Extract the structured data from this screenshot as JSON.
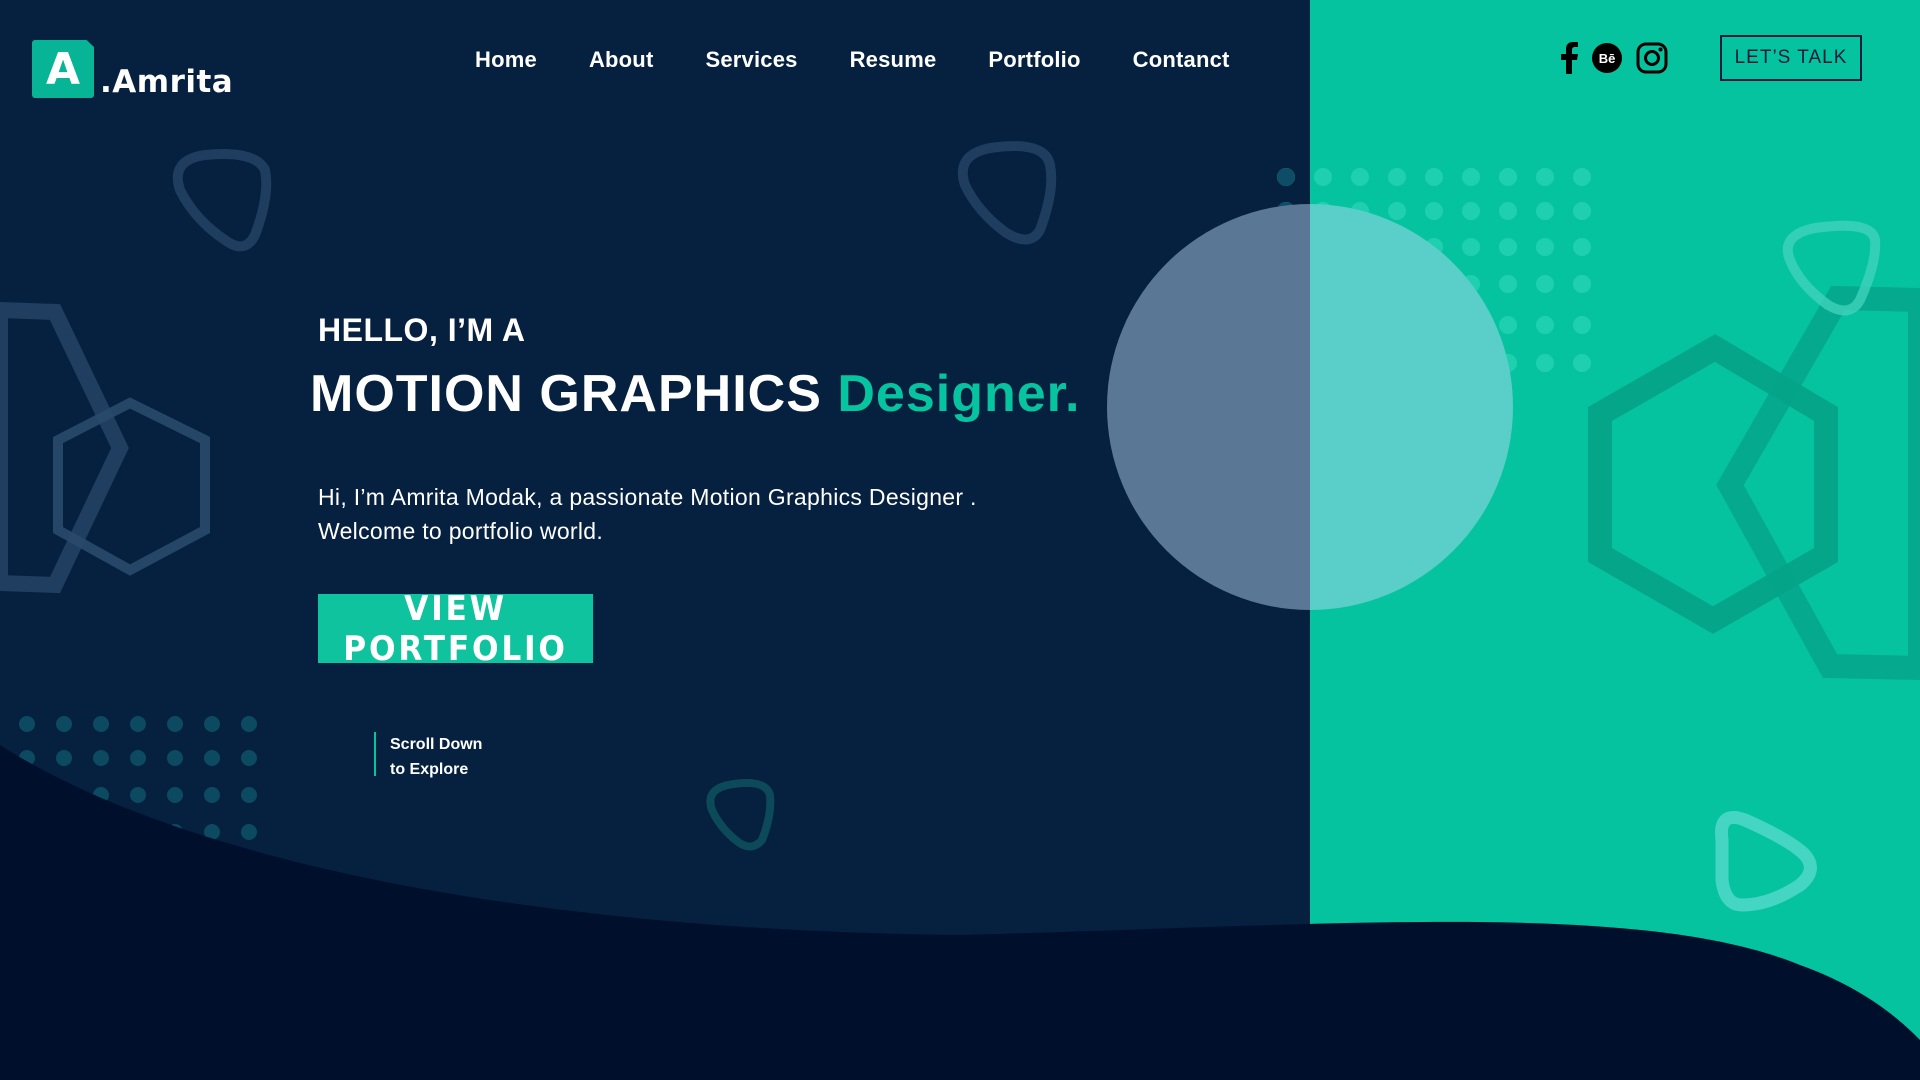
{
  "brand": {
    "logo_letter": "A",
    "name": ".Amrita"
  },
  "nav": {
    "items": [
      {
        "label": "Home"
      },
      {
        "label": "About"
      },
      {
        "label": "Services"
      },
      {
        "label": "Resume"
      },
      {
        "label": "Portfolio"
      },
      {
        "label": "Contanct"
      }
    ]
  },
  "social": {
    "facebook_icon": "facebook-icon",
    "behance_label": "Bē",
    "instagram_icon": "instagram-icon"
  },
  "header_cta": {
    "label": "LET’S TALK"
  },
  "hero": {
    "greeting": "HELLO, I’M A",
    "headline_main": "MOTION GRAPHICS",
    "headline_accent": "Designer.",
    "intro_line1": "Hi, I’m Amrita Modak, a passionate Motion Graphics Designer .",
    "intro_line2": "Welcome to portfolio world.",
    "cta_label": "VIEW PORTFOLIO",
    "scroll_line1": "Scroll Down",
    "scroll_line2": "to Explore"
  },
  "colors": {
    "navy": "#06203f",
    "deep_navy": "#000f2c",
    "teal": "#06c39f",
    "accent_text": "#07c4a0"
  }
}
